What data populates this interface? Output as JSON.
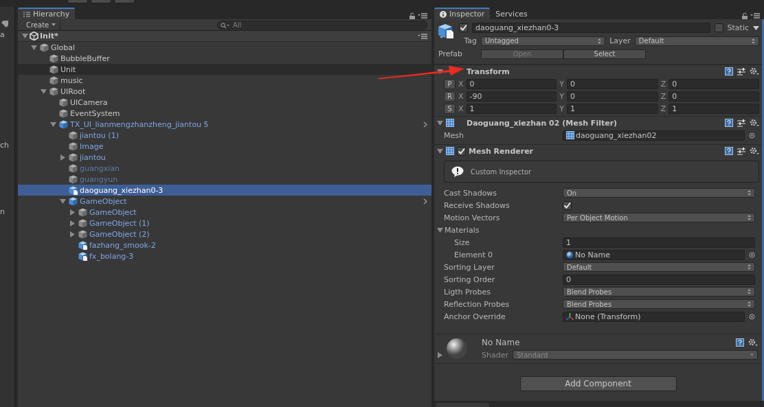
{
  "side_strip": {
    "texts": [
      "a",
      "ch",
      "n"
    ]
  },
  "hierarchy": {
    "tab": "Hierarchy",
    "create": "Create",
    "search_placeholder": "All",
    "scene": {
      "name": "Init*",
      "expanded": true
    },
    "items": [
      {
        "name": "Global",
        "kind": "object",
        "expanded": true,
        "selected": false,
        "hovered": false,
        "disabled": false,
        "children": [
          {
            "name": "BubbleBuffer",
            "kind": "object",
            "selected": false,
            "hovered": false,
            "disabled": false
          },
          {
            "name": "Unit",
            "kind": "object",
            "selected": false,
            "hovered": true,
            "disabled": false
          },
          {
            "name": "music",
            "kind": "object",
            "selected": false,
            "hovered": false,
            "disabled": false
          },
          {
            "name": "UIRoot",
            "kind": "object",
            "expanded": true,
            "selected": false,
            "hovered": false,
            "disabled": false,
            "children": [
              {
                "name": "UICamera",
                "kind": "object",
                "selected": false,
                "hovered": false,
                "disabled": false
              },
              {
                "name": "EventSystem",
                "kind": "object",
                "selected": false,
                "hovered": false,
                "disabled": false
              },
              {
                "name": "TX_UI_lianmengzhanzheng_jiantou 5",
                "kind": "prefab-root",
                "expanded": true,
                "selected": false,
                "hovered": false,
                "disabled": false,
                "children": [
                  {
                    "name": "jiantou (1)",
                    "kind": "prefab-child",
                    "selected": false,
                    "hovered": false,
                    "disabled": false
                  },
                  {
                    "name": "Image",
                    "kind": "prefab-child",
                    "selected": false,
                    "hovered": false,
                    "disabled": false
                  },
                  {
                    "name": "jiantou",
                    "kind": "prefab-child",
                    "expanded": false,
                    "selected": false,
                    "hovered": false,
                    "disabled": false
                  },
                  {
                    "name": "guangxian",
                    "kind": "prefab-child",
                    "selected": false,
                    "hovered": false,
                    "disabled": true
                  },
                  {
                    "name": "guangyun",
                    "kind": "prefab-child",
                    "selected": false,
                    "hovered": false,
                    "disabled": true
                  },
                  {
                    "name": "daoguang_xiezhan0-3",
                    "kind": "model",
                    "selected": true,
                    "hovered": false,
                    "disabled": false
                  },
                  {
                    "name": "GameObject",
                    "kind": "prefab-root",
                    "expanded": true,
                    "selected": false,
                    "hovered": false,
                    "disabled": false,
                    "children": [
                      {
                        "name": "GameObject",
                        "kind": "prefab-child",
                        "expanded": false,
                        "selected": false,
                        "hovered": false,
                        "disabled": false
                      },
                      {
                        "name": "GameObject (1)",
                        "kind": "prefab-child",
                        "expanded": false,
                        "selected": false,
                        "hovered": false,
                        "disabled": false
                      },
                      {
                        "name": "GameObject (2)",
                        "kind": "prefab-child",
                        "expanded": false,
                        "selected": false,
                        "hovered": false,
                        "disabled": false
                      },
                      {
                        "name": "fazhang_smook-2",
                        "kind": "model",
                        "selected": false,
                        "hovered": false,
                        "disabled": false
                      },
                      {
                        "name": "fx_bolang-3",
                        "kind": "model",
                        "selected": false,
                        "hovered": false,
                        "disabled": false
                      }
                    ]
                  }
                ]
              }
            ]
          }
        ]
      }
    ]
  },
  "inspector": {
    "tabs": [
      {
        "label": "Inspector",
        "selected": true
      },
      {
        "label": "Services",
        "selected": false
      }
    ],
    "object": {
      "active": true,
      "name": "daoguang_xiezhan0-3",
      "static": false,
      "static_label": "Static",
      "tag_label": "Tag",
      "tag": "Untagged",
      "layer_label": "Layer",
      "layer": "Default",
      "prefab_label": "Prefab",
      "prefab_buttons": [
        {
          "label": "Open",
          "disabled": true
        },
        {
          "label": "Select",
          "disabled": false
        }
      ]
    },
    "components": [
      {
        "kind": "transform",
        "title": "Transform",
        "expanded": true,
        "rows": [
          {
            "button": "P",
            "fields": [
              {
                "axis": "X",
                "value": "0"
              },
              {
                "axis": "Y",
                "value": "0"
              },
              {
                "axis": "Z",
                "value": "0"
              }
            ]
          },
          {
            "button": "R",
            "fields": [
              {
                "axis": "X",
                "value": "-90"
              },
              {
                "axis": "Y",
                "value": "0"
              },
              {
                "axis": "Z",
                "value": "0"
              }
            ]
          },
          {
            "button": "S",
            "fields": [
              {
                "axis": "X",
                "value": "1"
              },
              {
                "axis": "Y",
                "value": "1"
              },
              {
                "axis": "Z",
                "value": "1"
              }
            ]
          }
        ]
      },
      {
        "kind": "mesh_filter",
        "title": "Daoguang_xiezhan 02 (Mesh Filter)",
        "expanded": true,
        "properties": [
          {
            "label": "Mesh",
            "kind": "mesh",
            "value": "daoguang_xiezhan02"
          }
        ]
      },
      {
        "kind": "mesh_renderer",
        "title": "Mesh Renderer",
        "expanded": true,
        "enabled": true,
        "notice": "Custom Inspector",
        "properties": [
          {
            "label": "Cast Shadows",
            "kind": "dropdown",
            "value": "On"
          },
          {
            "label": "Receive Shadows",
            "kind": "checkbox",
            "checked": true
          },
          {
            "label": "Motion Vectors",
            "kind": "dropdown",
            "value": "Per Object Motion"
          },
          {
            "label": "Materials",
            "kind": "section",
            "expanded": true,
            "children": [
              {
                "label": "Size",
                "kind": "number",
                "value": "1"
              },
              {
                "label": "Element 0",
                "kind": "material",
                "value": "No Name"
              }
            ]
          },
          {
            "label": "Sorting Layer",
            "kind": "dropdown",
            "value": "Default"
          },
          {
            "label": "Sorting Order",
            "kind": "number",
            "value": "0"
          },
          {
            "label": "Ligth Probes",
            "kind": "dropdown",
            "value": "Blend Probes"
          },
          {
            "label": "Reflection Probes",
            "kind": "dropdown",
            "value": "Blend Probes"
          },
          {
            "label": "Anchor Override",
            "kind": "transform",
            "value": "None (Transform)"
          }
        ]
      }
    ],
    "material": {
      "name": "No Name",
      "expanded": false,
      "shader_label": "Shader",
      "shader": "Standard"
    },
    "add_component": "Add Component"
  }
}
